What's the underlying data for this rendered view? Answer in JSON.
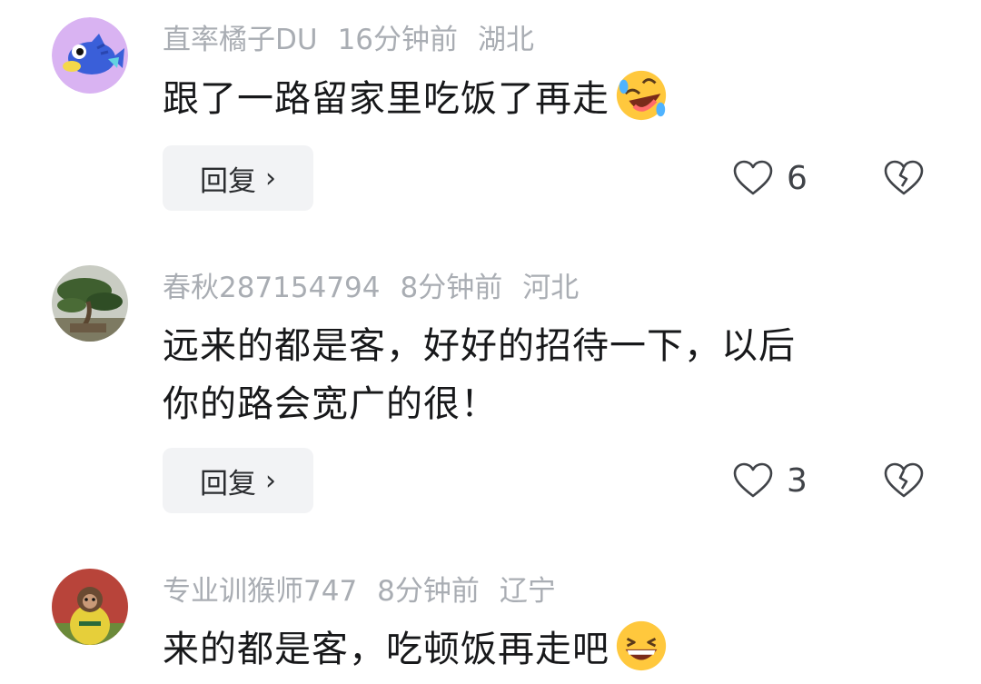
{
  "comments": [
    {
      "username": "直率橘子DU",
      "time": "16分钟前",
      "location": "湖北",
      "text": "跟了一路留家里吃饭了再走",
      "emoji": "rolling-laughing-emoji",
      "reply_label": "回复",
      "likes": "6",
      "avatar": "fish-avatar"
    },
    {
      "username": "春秋287154794",
      "time": "8分钟前",
      "location": "河北",
      "text_line1": "远来的都是客，好好的招待一下，以后",
      "text_line2": "你的路会宽广的很！",
      "reply_label": "回复",
      "likes": "3",
      "avatar": "bonsai-avatar"
    },
    {
      "username": "专业训猴师747",
      "time": "8分钟前",
      "location": "辽宁",
      "text": "来的都是客，吃顿饭再走吧",
      "emoji": "grinning-laughing-emoji",
      "avatar": "monkey-avatar"
    }
  ],
  "colors": {
    "meta_text": "#a9adb3",
    "body_text": "#17181a",
    "reply_bg": "#f2f3f5",
    "icon": "#404348"
  }
}
